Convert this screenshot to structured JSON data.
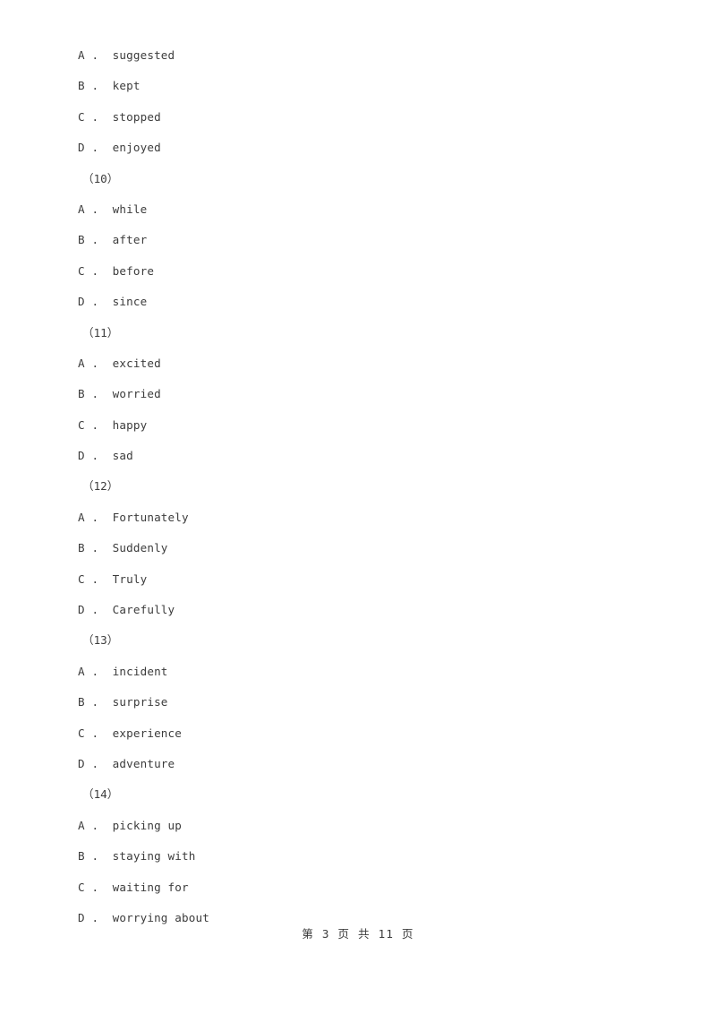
{
  "document": {
    "background_color": "#ffffff",
    "text_color": "#3c3c3c"
  },
  "groups": [
    {
      "number_label": "",
      "options": [
        {
          "letter": "A",
          "separator": " .  ",
          "text": "suggested"
        },
        {
          "letter": "B",
          "separator": " .  ",
          "text": "kept"
        },
        {
          "letter": "C",
          "separator": " .  ",
          "text": "stopped"
        },
        {
          "letter": "D",
          "separator": " .  ",
          "text": "enjoyed"
        }
      ]
    },
    {
      "number_label": "（10）",
      "options": [
        {
          "letter": "A",
          "separator": " .  ",
          "text": "while"
        },
        {
          "letter": "B",
          "separator": " .  ",
          "text": "after"
        },
        {
          "letter": "C",
          "separator": " .  ",
          "text": "before"
        },
        {
          "letter": "D",
          "separator": " .  ",
          "text": "since"
        }
      ]
    },
    {
      "number_label": "（11）",
      "options": [
        {
          "letter": "A",
          "separator": " .  ",
          "text": "excited"
        },
        {
          "letter": "B",
          "separator": " .  ",
          "text": "worried"
        },
        {
          "letter": "C",
          "separator": " .  ",
          "text": "happy"
        },
        {
          "letter": "D",
          "separator": " .  ",
          "text": "sad"
        }
      ]
    },
    {
      "number_label": "（12）",
      "options": [
        {
          "letter": "A",
          "separator": " .  ",
          "text": "Fortunately"
        },
        {
          "letter": "B",
          "separator": " .  ",
          "text": "Suddenly"
        },
        {
          "letter": "C",
          "separator": " .  ",
          "text": "Truly"
        },
        {
          "letter": "D",
          "separator": " .  ",
          "text": "Carefully"
        }
      ]
    },
    {
      "number_label": "（13）",
      "options": [
        {
          "letter": "A",
          "separator": " .  ",
          "text": "incident"
        },
        {
          "letter": "B",
          "separator": " .  ",
          "text": "surprise"
        },
        {
          "letter": "C",
          "separator": " .  ",
          "text": "experience"
        },
        {
          "letter": "D",
          "separator": " .  ",
          "text": "adventure"
        }
      ]
    },
    {
      "number_label": "（14）",
      "options": [
        {
          "letter": "A",
          "separator": " .  ",
          "text": "picking up"
        },
        {
          "letter": "B",
          "separator": " .  ",
          "text": "staying with"
        },
        {
          "letter": "C",
          "separator": " .  ",
          "text": "waiting for"
        },
        {
          "letter": "D",
          "separator": " .  ",
          "text": "worrying about"
        }
      ]
    }
  ],
  "footer": {
    "page_text": "第 3 页 共 11 页",
    "current_page": "3",
    "total_pages": "11"
  }
}
